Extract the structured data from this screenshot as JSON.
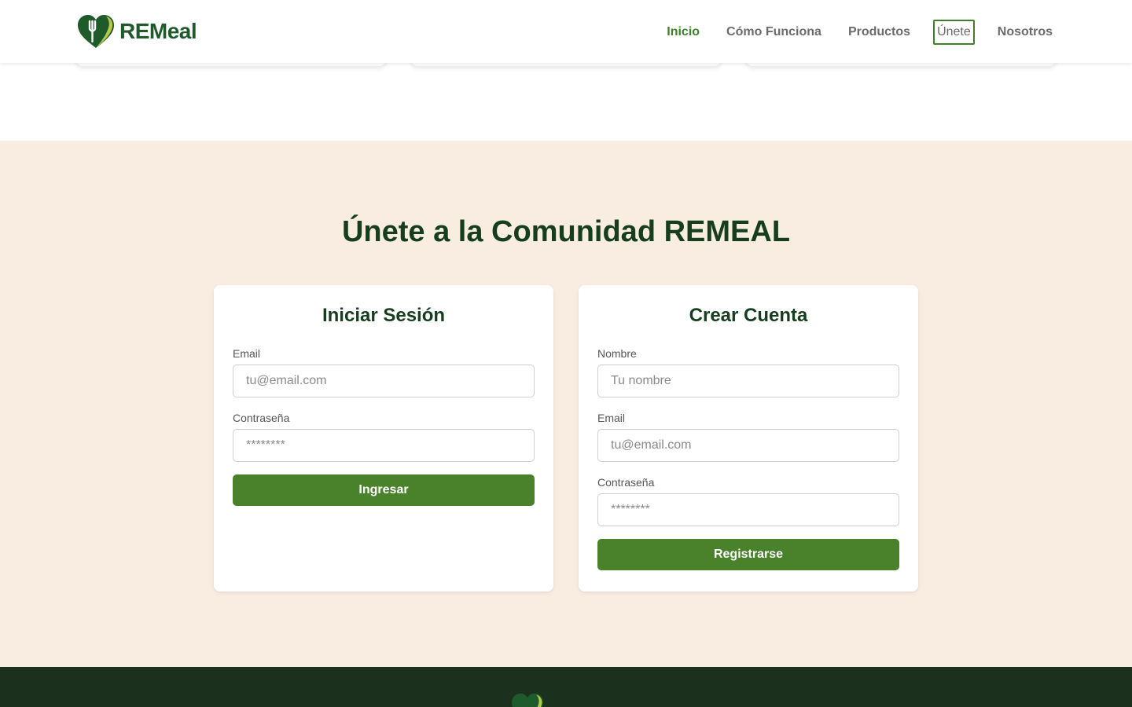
{
  "brand": {
    "name": "REMeal"
  },
  "nav": {
    "items": [
      {
        "label": "Inicio"
      },
      {
        "label": "Cómo Funciona"
      },
      {
        "label": "Productos"
      },
      {
        "label": "Únete"
      },
      {
        "label": "Nosotros"
      }
    ]
  },
  "join": {
    "title": "Únete a la Comunidad REMEAL",
    "login": {
      "title": "Iniciar Sesión",
      "email_label": "Email",
      "email_placeholder": "tu@email.com",
      "password_label": "Contraseña",
      "password_placeholder": "********",
      "submit_label": "Ingresar"
    },
    "register": {
      "title": "Crear Cuenta",
      "name_label": "Nombre",
      "name_placeholder": "Tu nombre",
      "email_label": "Email",
      "email_placeholder": "tu@email.com",
      "password_label": "Contraseña",
      "password_placeholder": "********",
      "submit_label": "Registrarse"
    }
  },
  "colors": {
    "primary_green": "#4a822c",
    "dark_green": "#173d1f",
    "section_bg": "#f9ede2",
    "footer_bg": "#1b311e"
  },
  "icons": {
    "logo": "heart-fork-icon"
  }
}
